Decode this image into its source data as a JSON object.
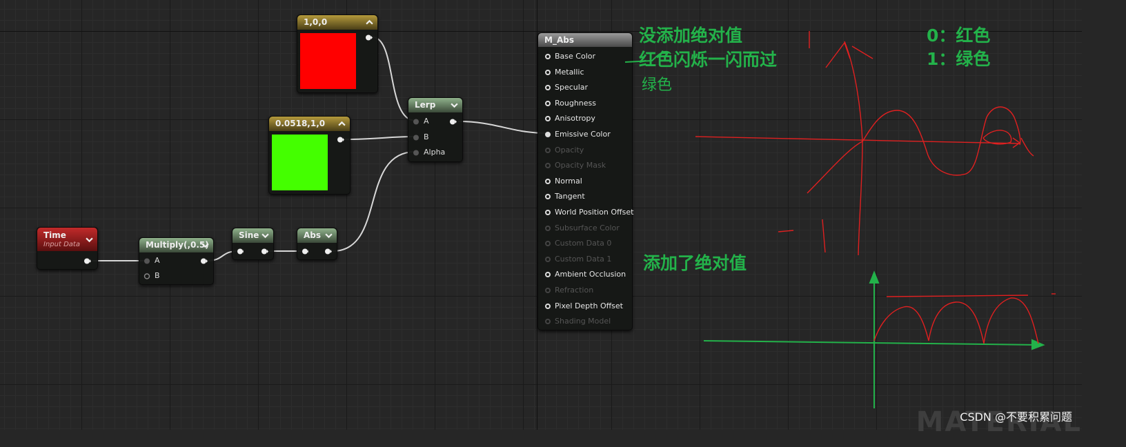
{
  "nodes": {
    "red_const": {
      "title": "1,0,0",
      "color": "#ff0000"
    },
    "green_const": {
      "title": "0.0518,1,0",
      "color": "#44ff00"
    },
    "lerp": {
      "title": "Lerp",
      "pins": {
        "a": "A",
        "b": "B",
        "alpha": "Alpha"
      }
    },
    "time": {
      "title": "Time",
      "subtitle": "Input Data"
    },
    "multiply": {
      "title": "Multiply(,0.5)",
      "pins": {
        "a": "A",
        "b": "B"
      }
    },
    "sine": {
      "title": "Sine"
    },
    "abs": {
      "title": "Abs"
    }
  },
  "material": {
    "title": "M_Abs",
    "inputs": [
      {
        "label": "Base Color",
        "state": "active"
      },
      {
        "label": "Metallic",
        "state": "active"
      },
      {
        "label": "Specular",
        "state": "active"
      },
      {
        "label": "Roughness",
        "state": "active"
      },
      {
        "label": "Anisotropy",
        "state": "active"
      },
      {
        "label": "Emissive Color",
        "state": "connected"
      },
      {
        "label": "Opacity",
        "state": "disabled"
      },
      {
        "label": "Opacity Mask",
        "state": "disabled"
      },
      {
        "label": "Normal",
        "state": "active"
      },
      {
        "label": "Tangent",
        "state": "active"
      },
      {
        "label": "World Position Offset",
        "state": "active"
      },
      {
        "label": "Subsurface Color",
        "state": "disabled"
      },
      {
        "label": "Custom Data 0",
        "state": "disabled"
      },
      {
        "label": "Custom Data 1",
        "state": "disabled"
      },
      {
        "label": "Ambient Occlusion",
        "state": "active"
      },
      {
        "label": "Refraction",
        "state": "disabled"
      },
      {
        "label": "Pixel Depth Offset",
        "state": "active"
      },
      {
        "label": "Shading Model",
        "state": "disabled"
      }
    ]
  },
  "annotations": {
    "no_abs": "没添加绝对值",
    "flash": "红色闪烁一闪而过",
    "green": "绿色",
    "legend_0": "0：红色",
    "legend_1": "1：绿色",
    "with_abs": "添加了绝对值",
    "ink_color": "#23b24a",
    "sketch_color": "#e02020"
  },
  "watermark": "CSDN @不要积累问题",
  "background_word": "MATERIAL"
}
